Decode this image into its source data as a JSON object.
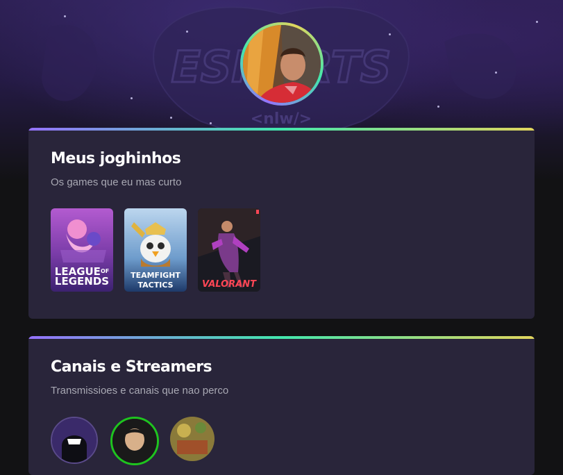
{
  "hero": {
    "logo_text": "ESPORTS",
    "logo_subtext": "<nlw/>"
  },
  "profile": {
    "avatar_alt": "Foto de perfil"
  },
  "games_section": {
    "title": "Meus joghinhos",
    "subtitle": "Os games que eu mas curto",
    "games": [
      {
        "line1": "LEAGUE",
        "line1_small": "OF",
        "line2": "LEGENDS"
      },
      {
        "line1": "TEAMFIGHT",
        "line2": "TACTICS"
      },
      {
        "line1": "VALORANT"
      }
    ]
  },
  "streamers_section": {
    "title": "Canais e Streamers",
    "subtitle": "Transmissioes e canais que nao perco"
  },
  "colors": {
    "gradient_start": "#9572fc",
    "gradient_mid": "#43e7ad",
    "gradient_end": "#e1d55d",
    "card_bg": "#29253a",
    "page_bg": "#121214",
    "text_muted": "#a8a8b3"
  }
}
